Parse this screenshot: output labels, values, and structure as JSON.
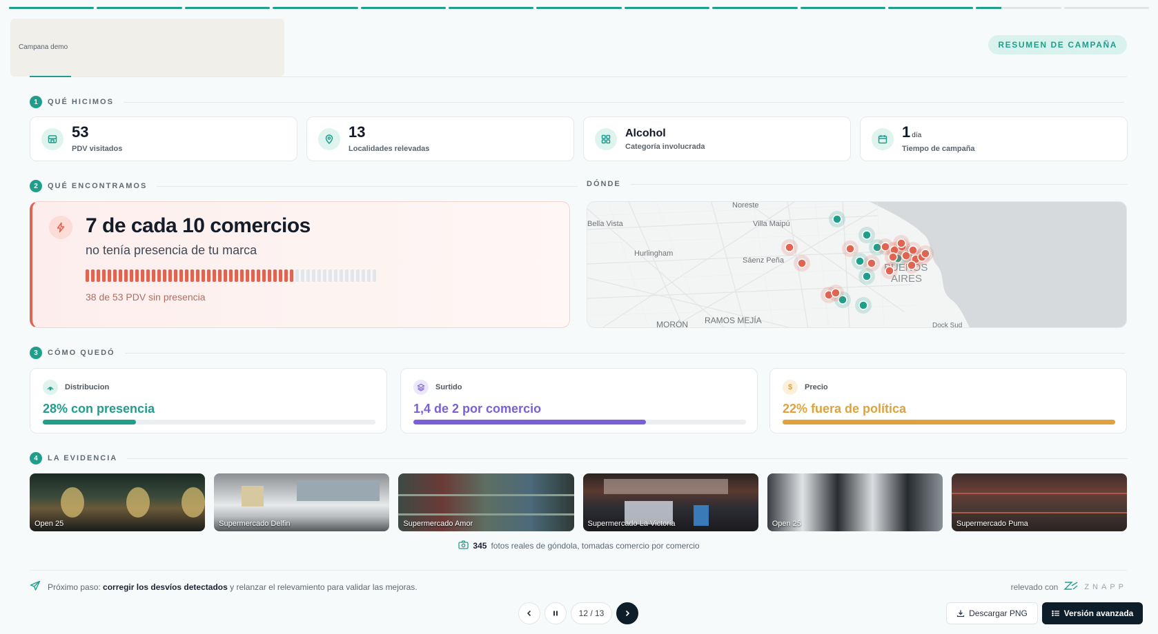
{
  "progress": {
    "segments": 13,
    "current": 12,
    "current_fill": 0.3
  },
  "brand": {
    "label": "Campana demo"
  },
  "header": {
    "summary_label": "RESUMEN DE CAMPAÑA"
  },
  "sections": {
    "s1": {
      "num": "1",
      "title": "QUÉ HICIMOS"
    },
    "s2": {
      "num": "2",
      "title": "QUÉ ENCONTRAMOS"
    },
    "where": {
      "title": "DÓNDE"
    },
    "s3": {
      "num": "3",
      "title": "CÓMO QUEDÓ"
    },
    "s4": {
      "num": "4",
      "title": "LA EVIDENCIA"
    }
  },
  "stats": [
    {
      "icon": "store-icon",
      "value": "53",
      "unit": "",
      "label": "PDV visitados"
    },
    {
      "icon": "map-pin-icon",
      "value": "13",
      "unit": "",
      "label": "Localidades relevadas"
    },
    {
      "icon": "grid-icon",
      "value": "Alcohol",
      "unit": "",
      "label": "Categoría involucrada"
    },
    {
      "icon": "calendar-icon",
      "value": "1",
      "unit": "día",
      "label": "Tiempo de campaña"
    }
  ],
  "finding": {
    "title": "7 de cada 10 comercios",
    "subtitle": "no tenía presencia de tu marca",
    "absent": 38,
    "total": 53,
    "footnote": "38 de 53 PDV sin presencia",
    "accent": "#e06452"
  },
  "map": {
    "labels": [
      "Noreste",
      "Bella Vista",
      "Villa Maipú",
      "Hurlingham",
      "Sáenz Peña",
      "BUENOS",
      "AIRES",
      "MORÓN",
      "RAMOS MEJÍA",
      "Dock Sud"
    ]
  },
  "metrics": [
    {
      "icon": "signal-icon",
      "title": "Distribucion",
      "value": "28% con presencia",
      "fill": 0.28,
      "color": "#1f9e8c",
      "icon_bg": "#dff3ef"
    },
    {
      "icon": "cube-icon",
      "title": "Surtido",
      "value": "1,4 de 2 por comercio",
      "fill": 0.7,
      "color": "#7b5fd6",
      "icon_bg": "#ece7fa"
    },
    {
      "icon": "dollar-icon",
      "title": "Precio",
      "value": "22% fuera de política",
      "fill": 1.0,
      "color": "#e0a23a",
      "icon_bg": "#fbf0dc"
    }
  ],
  "photos": [
    {
      "caption": "Open 25"
    },
    {
      "caption": "Supermercado Delfin"
    },
    {
      "caption": "Supermercado Amor"
    },
    {
      "caption": "Supermercado La Victoria"
    },
    {
      "caption": "Open 25"
    },
    {
      "caption": "Supermercado Puma"
    }
  ],
  "photo_note": {
    "count": "345",
    "text": "fotos reales de góndola, tomadas comercio por comercio"
  },
  "footer": {
    "next_prefix": "Próximo paso:",
    "next_bold": "corregir los desvíos detectados",
    "next_suffix": "y relanzar el relevamiento para validar las mejoras.",
    "relevado": "relevado con",
    "brand": "ZNAPP"
  },
  "controls": {
    "page": "12 / 13",
    "download_label": "Descargar PNG",
    "advanced_label": "Versión avanzada"
  }
}
